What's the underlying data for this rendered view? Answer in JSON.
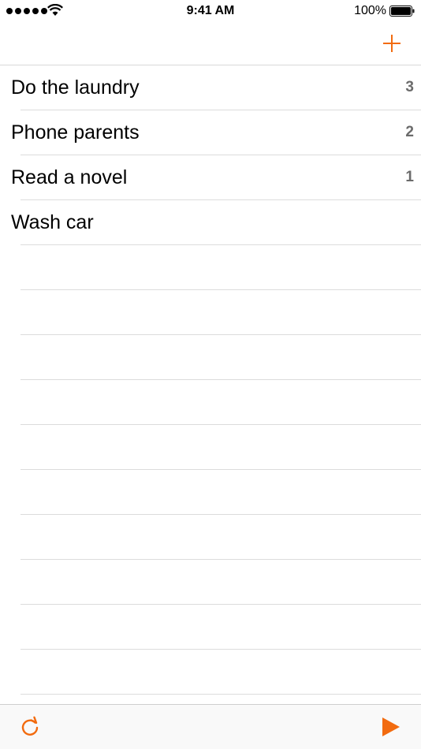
{
  "status_bar": {
    "time": "9:41 AM",
    "battery_percent": "100%",
    "signal_bars": 5
  },
  "nav": {
    "add_icon": "plus-icon",
    "accent_color": "#F26B0F"
  },
  "tasks": [
    {
      "title": "Do the laundry",
      "count": "3"
    },
    {
      "title": "Phone parents",
      "count": "2"
    },
    {
      "title": "Read a novel",
      "count": "1"
    },
    {
      "title": "Wash car",
      "count": ""
    }
  ],
  "toolbar": {
    "refresh_icon": "refresh-icon",
    "play_icon": "play-icon"
  }
}
